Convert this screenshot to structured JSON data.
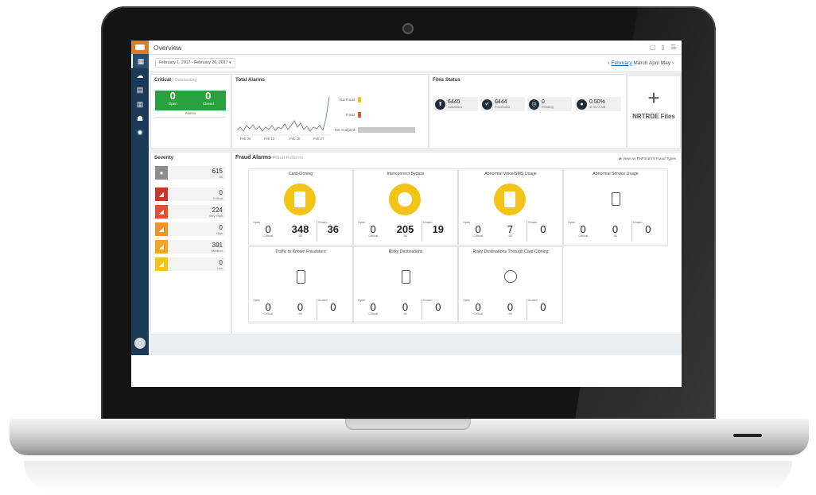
{
  "app": {
    "title": "Overview"
  },
  "filters": {
    "date_range": "February 1, 2017 - February 26, 2017 ▾",
    "months": {
      "current": "February",
      "next1": "March",
      "next2": "April",
      "next3": "May"
    }
  },
  "critical": {
    "title": "Critical",
    "subtitle": "/ Outstanding",
    "open_value": "0",
    "open_label": "Open",
    "closed_value": "0",
    "closed_label": "Closed",
    "caption": "Alarms"
  },
  "total_alarms": {
    "title": "Total Alarms",
    "bar_labels": [
      "Not Fraud",
      "Fraud",
      "Not Analyzed"
    ],
    "x_labels": [
      "Feb 06",
      "Feb 13",
      "Feb 20",
      "Feb 27"
    ],
    "bar_colors": [
      "#f2c418",
      "#e0522b",
      "#c8c8c8"
    ]
  },
  "files_status": {
    "title": "Files Status",
    "items": [
      {
        "value": "6445",
        "label": "Submitted",
        "icon": "upload-icon"
      },
      {
        "value": "6444",
        "label": "Processed",
        "icon": "check-icon"
      },
      {
        "value": "0",
        "label": "Pending",
        "icon": "clock-icon"
      },
      {
        "value": "0.50%",
        "label": "of 3072 MB",
        "icon": "disk-icon"
      }
    ]
  },
  "nrtrde": {
    "label": "NRTRDE Files"
  },
  "severity": {
    "title": "Severity",
    "rows": [
      {
        "value": "615",
        "label": "All",
        "color": "#8c8c8c"
      },
      {
        "value": "0",
        "label": "Critical",
        "color": "#c0392b"
      },
      {
        "value": "224",
        "label": "Very High",
        "color": "#e0522b"
      },
      {
        "value": "0",
        "label": "High",
        "color": "#f0922b"
      },
      {
        "value": "391",
        "label": "Medium",
        "color": "#f2a521"
      },
      {
        "value": "0",
        "label": "Low",
        "color": "#f2c418"
      }
    ]
  },
  "fraud_alarms": {
    "title": "Fraud Alarms",
    "subtitle": "Fraud Patterns",
    "link": "View as TMForum's Fraud Types",
    "cards": [
      {
        "title": "Card Cloning",
        "highlight": true,
        "open_label": "Open",
        "critical": "0",
        "critical_label": "Critical",
        "all": "348",
        "all_label": "All",
        "closed_label": "Closed",
        "closed": "36"
      },
      {
        "title": "Interconnect Bypass",
        "highlight": true,
        "open_label": "Open",
        "critical": "0",
        "critical_label": "Critical",
        "all": "205",
        "all_label": "All",
        "closed_label": "Closed",
        "closed": "19"
      },
      {
        "title": "Abnormal Voice/SMS Usage",
        "highlight": true,
        "open_label": "Open",
        "critical": "0",
        "critical_label": "Critical",
        "all": "7",
        "all_label": "All",
        "closed_label": "Closed",
        "closed": "0"
      },
      {
        "title": "Abnormal Service Usage",
        "highlight": false,
        "open_label": "Open",
        "critical": "0",
        "critical_label": "Critical",
        "all": "0",
        "all_label": "All",
        "closed_label": "Closed",
        "closed": "0"
      },
      {
        "title": "Traffic to Known Fraudsters",
        "highlight": false,
        "open_label": "Open",
        "critical": "0",
        "critical_label": "Critical",
        "all": "0",
        "all_label": "All",
        "closed_label": "Closed",
        "closed": "0"
      },
      {
        "title": "Risky Destinations",
        "highlight": false,
        "open_label": "Open",
        "critical": "0",
        "critical_label": "Critical",
        "all": "0",
        "all_label": "All",
        "closed_label": "Closed",
        "closed": "0"
      },
      {
        "title": "Risky Destinations Through Card Cloning",
        "highlight": false,
        "open_label": "Open",
        "critical": "0",
        "critical_label": "Critical",
        "all": "0",
        "all_label": "All",
        "closed_label": "Closed",
        "closed": "0"
      }
    ]
  },
  "colors": {
    "rail": "#1b3a57",
    "brand": "#e07b24",
    "critical_green": "#29a13c",
    "highlight_yellow": "#f2c418"
  }
}
